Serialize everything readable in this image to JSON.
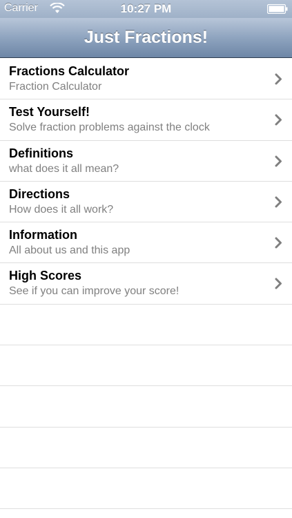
{
  "status_bar": {
    "carrier": "Carrier",
    "time": "10:27 PM",
    "wifi_icon": "wifi-icon",
    "battery_icon": "battery-icon"
  },
  "nav": {
    "title": "Just Fractions!"
  },
  "menu": [
    {
      "title": "Fractions Calculator",
      "subtitle": "Fraction Calculator"
    },
    {
      "title": "Test Yourself!",
      "subtitle": "Solve fraction problems against the clock"
    },
    {
      "title": "Definitions",
      "subtitle": "what does it all mean?"
    },
    {
      "title": "Directions",
      "subtitle": "How does it all work?"
    },
    {
      "title": "Information",
      "subtitle": "All about us and this app"
    },
    {
      "title": "High Scores",
      "subtitle": "See if you can improve your score!"
    }
  ],
  "colors": {
    "nav_bar": "#8fa4bf",
    "separator": "#dedede",
    "subtitle_text": "#808080",
    "chevron": "#7f7f7f"
  }
}
